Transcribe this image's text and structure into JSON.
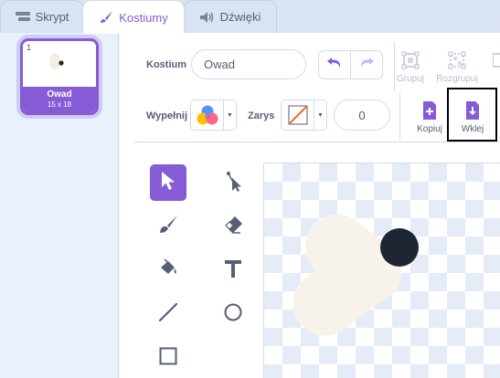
{
  "tabs": [
    {
      "label": "Skrypt",
      "icon": "code-icon",
      "active": false
    },
    {
      "label": "Kostiumy",
      "icon": "brush-icon",
      "active": true
    },
    {
      "label": "Dźwięki",
      "icon": "speaker-icon",
      "active": false
    }
  ],
  "costumes": [
    {
      "number": "1",
      "name": "Owad",
      "size": "15 x 18",
      "selected": true
    }
  ],
  "editor": {
    "costume_label": "Kostium",
    "costume_name": "Owad",
    "group_label": "Grupuj",
    "ungroup_label": "Rozgrupuj",
    "fill_label": "Wypełnij",
    "outline_label": "Zarys",
    "outline_width": "0",
    "copy_label": "Kopiuj",
    "paste_label": "Wklej"
  },
  "tools": [
    {
      "name": "select-tool",
      "icon": "arrow-icon",
      "selected": true
    },
    {
      "name": "reshape-tool",
      "icon": "reshape-icon",
      "selected": false
    },
    {
      "name": "brush-tool",
      "icon": "brush-icon",
      "selected": false
    },
    {
      "name": "eraser-tool",
      "icon": "eraser-icon",
      "selected": false
    },
    {
      "name": "fill-tool",
      "icon": "bucket-icon",
      "selected": false
    },
    {
      "name": "text-tool",
      "icon": "text-icon",
      "selected": false
    },
    {
      "name": "line-tool",
      "icon": "line-icon",
      "selected": false
    },
    {
      "name": "circle-tool",
      "icon": "circle-icon",
      "selected": false
    },
    {
      "name": "rectangle-tool",
      "icon": "rectangle-icon",
      "selected": false
    }
  ],
  "colors": {
    "accent": "#855cd6",
    "text": "#575e75",
    "wing": "#f8f3ea",
    "body": "#1f2633",
    "outline_swatch_slash": "#f26b21"
  }
}
